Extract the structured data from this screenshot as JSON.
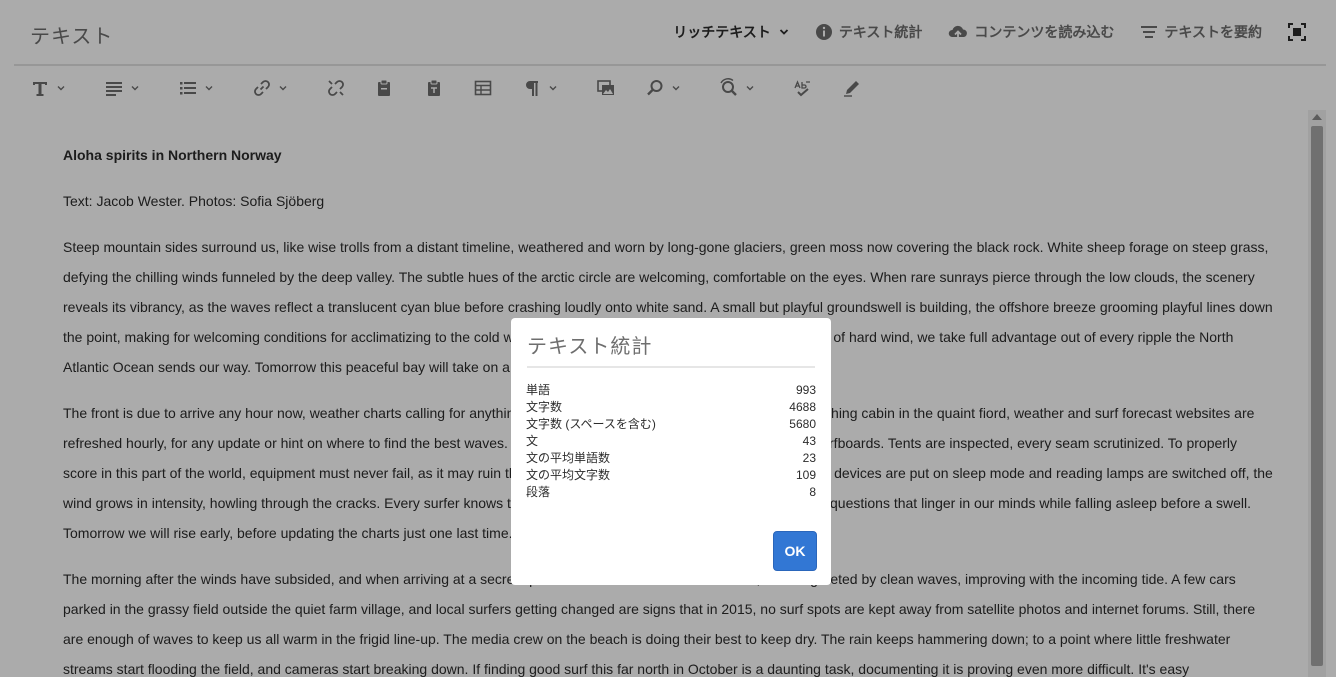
{
  "header": {
    "title": "テキスト",
    "mode_label": "リッチテキスト",
    "stats_label": "テキスト統計",
    "import_label": "コンテンツを読み込む",
    "summarize_label": "テキストを要約"
  },
  "toolbar": {
    "icons": [
      "text-format-icon",
      "align-icon",
      "list-icon",
      "link-icon",
      "unlink-icon",
      "paste-icon",
      "paste-plain-icon",
      "table-icon",
      "paragraph-icon",
      "image-icon",
      "find-icon",
      "find-replace-icon",
      "spellcheck-icon",
      "edit-icon"
    ]
  },
  "document": {
    "heading": "Aloha spirits in Northern Norway",
    "byline": "Text: Jacob Wester. Photos: Sofia Sjöberg",
    "p1": "Steep mountain sides surround us, like wise trolls from a distant timeline, weathered and worn by long-gone glaciers, green moss now covering the black rock. White sheep forage on steep grass, defying the chilling winds funneled by the deep valley. The subtle hues of the arctic circle are welcoming, comfortable on the eyes. When rare sunrays pierce through the low clouds, the scenery reveals its vibrancy, as the waves reflect a translucent cyan blue before crashing loudly onto white sand. A small but playful groundswell is building, the offshore breeze grooming playful lines down the point, making for welcoming conditions for acclimatizing to the cold water. Knowing this is our last surf before a few days of hard wind, we take full advantage out of every ripple the North Atlantic Ocean sends our way. Tomorrow this peaceful bay will take on a more hostile appearance.",
    "p2": "The front is due to arrive any hour now, weather charts calling for anything from gale force winds to a proper storm. In our fishing cabin in the quaint fiord, weather and surf forecast websites are refreshed hourly, for any update or hint on where to find the best waves. Equipment is made ready, fresh wax coat on the surfboards. Tents are inspected, every seam scrutinized. To properly score in this part of the world, equipment must never fail, as it may ruin the session, the whole trip even. As our social media devices are put on sleep mode and reading lamps are switched off, the wind grows in intensity, howling through the cracks. Every surfer knows the feeling of combined anxiety and excitement, the questions that linger in our minds while falling asleep before a swell. Tomorrow we will rise early, before updating the charts just one last time.",
    "p3": "The morning after the winds have subsided, and when arriving at a secret spot on the northern side of the island, we are greeted by clean waves, improving with the incoming tide. A few cars parked in the grassy field outside the quiet farm village, and local surfers getting changed are signs that in 2015, no surf spots are kept away from satellite photos and internet forums. Still, there are enough of waves to keep us all warm in the frigid line-up. The media crew on the beach is doing their best to keep dry. The rain keeps hammering down; to a point where little freshwater streams start flooding the field, and cameras start breaking down. If finding good surf this far north in October is a daunting task, documenting it is proving even more difficult. It's easy"
  },
  "dialog": {
    "title": "テキスト統計",
    "ok_label": "OK",
    "stats": [
      {
        "label": "単語",
        "value": "993"
      },
      {
        "label": "文字数",
        "value": "4688"
      },
      {
        "label": "文字数 (スペースを含む)",
        "value": "5680"
      },
      {
        "label": "文",
        "value": "43"
      },
      {
        "label": "文の平均単語数",
        "value": "23"
      },
      {
        "label": "文の平均文字数",
        "value": "109"
      },
      {
        "label": "段落",
        "value": "8"
      }
    ]
  }
}
